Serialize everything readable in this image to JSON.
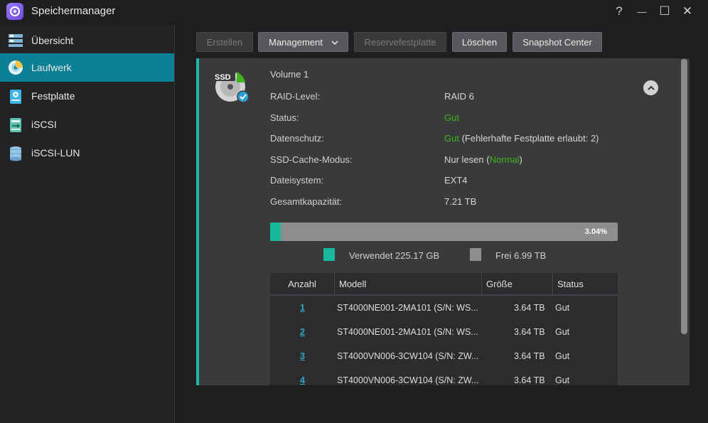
{
  "window": {
    "title": "Speichermanager",
    "controls": {
      "help": "?",
      "minimize": "—",
      "maximize": "☐",
      "close": "✕"
    }
  },
  "sidebar": {
    "items": [
      {
        "label": "Übersicht",
        "icon": "overview-icon"
      },
      {
        "label": "Laufwerk",
        "icon": "volume-icon",
        "active": true
      },
      {
        "label": "Festplatte",
        "icon": "disk-icon"
      },
      {
        "label": "iSCSI",
        "icon": "iscsi-icon"
      },
      {
        "label": "iSCSI-LUN",
        "icon": "iscsi-lun-icon"
      }
    ]
  },
  "toolbar": {
    "create_label": "Erstellen",
    "management_label": "Management",
    "spare_label": "Reservefestplatte",
    "delete_label": "Löschen",
    "snapshot_label": "Snapshot Center"
  },
  "volume": {
    "badge": "SSD",
    "name": "Volume 1",
    "raid_label": "RAID-Level:",
    "raid_value": "RAID 6",
    "status_label": "Status:",
    "status_value": "Gut",
    "protection_label": "Datenschutz:",
    "protection_value": "Gut",
    "protection_note": " (Fehlerhafte Festplatte erlaubt: 2)",
    "ssd_cache_label": "SSD-Cache-Modus:",
    "ssd_cache_value": "Nur lesen (",
    "ssd_cache_state": "Normal",
    "ssd_cache_close": ")",
    "fs_label": "Dateisystem:",
    "fs_value": "EXT4",
    "capacity_label": "Gesamtkapazität:",
    "capacity_value": "7.21 TB",
    "usage_percent_text": "3.04%",
    "usage_fraction": 0.0304,
    "used_label": "Verwendet 225.17 GB",
    "free_label": "Frei 6.99 TB"
  },
  "colors": {
    "accent": "#0b7f95",
    "used": "#18b89c",
    "free": "#8e8e90",
    "good": "#3fb51d"
  },
  "table": {
    "headers": [
      "Anzahl",
      "Modell",
      "Größe",
      "Status"
    ],
    "rows": [
      {
        "num": "1",
        "model": "ST4000NE001-2MA101 (S/N: WS...",
        "size": "3.64 TB",
        "status": "Gut"
      },
      {
        "num": "2",
        "model": "ST4000NE001-2MA101 (S/N: WS...",
        "size": "3.64 TB",
        "status": "Gut"
      },
      {
        "num": "3",
        "model": "ST4000VN006-3CW104 (S/N: ZW...",
        "size": "3.64 TB",
        "status": "Gut"
      },
      {
        "num": "4",
        "model": "ST4000VN006-3CW104 (S/N: ZW...",
        "size": "3.64 TB",
        "status": "Gut"
      }
    ]
  }
}
